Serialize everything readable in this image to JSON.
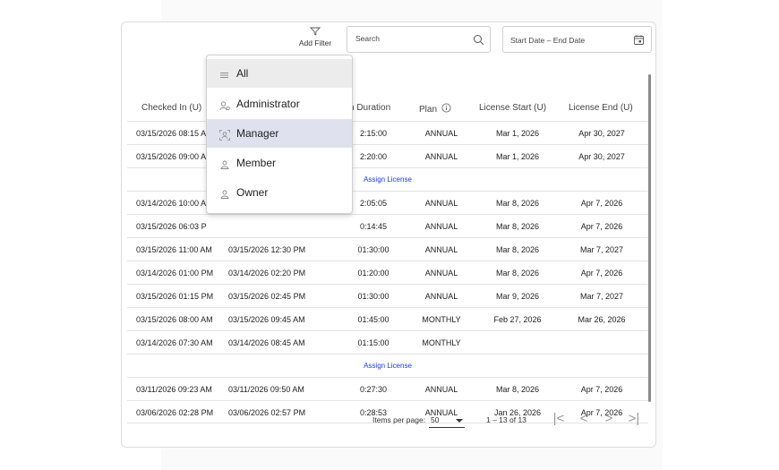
{
  "toolbar": {
    "add_filter_label": "Add Filter",
    "search_placeholder": "Search",
    "date_range_label": "Start Date – End Date"
  },
  "filter_menu": {
    "items": [
      {
        "label": "All",
        "icon": "list-icon",
        "state": "hover"
      },
      {
        "label": "Administrator",
        "icon": "admin-user-icon",
        "state": "normal"
      },
      {
        "label": "Manager",
        "icon": "manager-user-icon",
        "state": "active"
      },
      {
        "label": "Member",
        "icon": "member-user-icon",
        "state": "normal"
      },
      {
        "label": "Owner",
        "icon": "owner-user-icon",
        "state": "normal"
      }
    ]
  },
  "table": {
    "headers": {
      "checked_in": "Checked In (U)",
      "duration": "n Duration",
      "plan": "Plan",
      "license_start": "License Start (U)",
      "license_end": "License End (U)"
    },
    "assign_license_label": "Assign License",
    "rows": [
      {
        "checked_in": "03/15/2026 08:15 A",
        "checked_out": "",
        "duration": "2:15:00",
        "plan": "ANNUAL",
        "license_start": "Mar 1, 2026",
        "license_end": "Apr 30, 2027"
      },
      {
        "checked_in": "03/15/2026 09:00 A",
        "checked_out": "",
        "duration": "2:20:00",
        "plan": "ANNUAL",
        "license_start": "Mar 1, 2026",
        "license_end": "Apr 30, 2027"
      },
      {
        "assign": true
      },
      {
        "checked_in": "03/14/2026 10:00 A",
        "checked_out": "",
        "duration": "2:05:05",
        "plan": "ANNUAL",
        "license_start": "Mar 8, 2026",
        "license_end": "Apr 7, 2026"
      },
      {
        "checked_in": "03/15/2026 06:03 P",
        "checked_out": "",
        "duration": "0:14:45",
        "plan": "ANNUAL",
        "license_start": "Mar 8, 2026",
        "license_end": "Apr 7, 2026"
      },
      {
        "checked_in": "03/15/2026 11:00 AM",
        "checked_out": "03/15/2026 12:30 PM",
        "duration": "01:30:00",
        "plan": "ANNUAL",
        "license_start": "Mar 8, 2026",
        "license_end": "Mar 7, 2027"
      },
      {
        "checked_in": "03/14/2026 01:00 PM",
        "checked_out": "03/14/2026 02:20 PM",
        "duration": "01:20:00",
        "plan": "ANNUAL",
        "license_start": "Mar 8, 2026",
        "license_end": "Apr 7, 2026"
      },
      {
        "checked_in": "03/15/2026 01:15 PM",
        "checked_out": "03/15/2026 02:45 PM",
        "duration": "01:30:00",
        "plan": "ANNUAL",
        "license_start": "Mar 9, 2026",
        "license_end": "Mar 7, 2027"
      },
      {
        "checked_in": "03/15/2026 08:00 AM",
        "checked_out": "03/15/2026 09:45 AM",
        "duration": "01:45:00",
        "plan": "MONTHLY",
        "license_start": "Feb 27, 2026",
        "license_end": "Mar 26, 2026"
      },
      {
        "checked_in": "03/14/2026 07:30 AM",
        "checked_out": "03/14/2026 08:45 AM",
        "duration": "01:15:00",
        "plan": "MONTHLY",
        "license_start": "",
        "license_end": ""
      },
      {
        "assign": true
      },
      {
        "checked_in": "03/11/2026 09:23 AM",
        "checked_out": "03/11/2026 09:50 AM",
        "duration": "0:27:30",
        "plan": "ANNUAL",
        "license_start": "Mar 8, 2026",
        "license_end": "Apr 7, 2026"
      },
      {
        "checked_in": "03/06/2026 02:28 PM",
        "checked_out": "03/06/2026 02:57 PM",
        "duration": "0:28:53",
        "plan": "ANNUAL",
        "license_start": "Jan 26, 2026",
        "license_end": "Apr 7, 2026"
      }
    ]
  },
  "pagination": {
    "items_per_page_label": "Items per page:",
    "items_per_page_value": "50",
    "range_label": "1 – 13 of 13",
    "first_icon": "|<",
    "prev_icon": "<",
    "next_icon": ">",
    "last_icon": ">|"
  }
}
